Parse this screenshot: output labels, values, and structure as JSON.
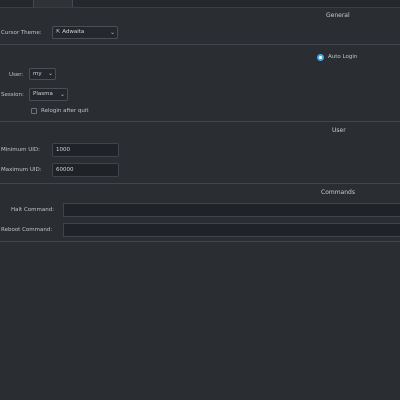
{
  "sections": {
    "general": "General",
    "user": "User",
    "commands": "Commands"
  },
  "general": {
    "cursor_theme_label": "Cursor Theme:",
    "cursor_theme_value": "Adwaita",
    "auto_login_label": "Auto Login",
    "auto_login_checked": true,
    "user_label": "User:",
    "user_value": "my",
    "session_label": "Session:",
    "session_value": "Plasma",
    "relogin_label": "Relogin after quit",
    "relogin_checked": false
  },
  "user": {
    "minimum_uid_label": "Minimum UID:",
    "minimum_uid_value": "1000",
    "maximum_uid_label": "Maximum UID:",
    "maximum_uid_value": "60000"
  },
  "commands": {
    "halt_label": "Halt Command:",
    "halt_value": "",
    "reboot_label": "Reboot Command:",
    "reboot_value": ""
  },
  "icons": {
    "cursor": "cursor-pointer-icon",
    "dropdown": "chevron-down-icon"
  },
  "colors": {
    "background": "#2a2d31",
    "accent": "#3daee9"
  }
}
